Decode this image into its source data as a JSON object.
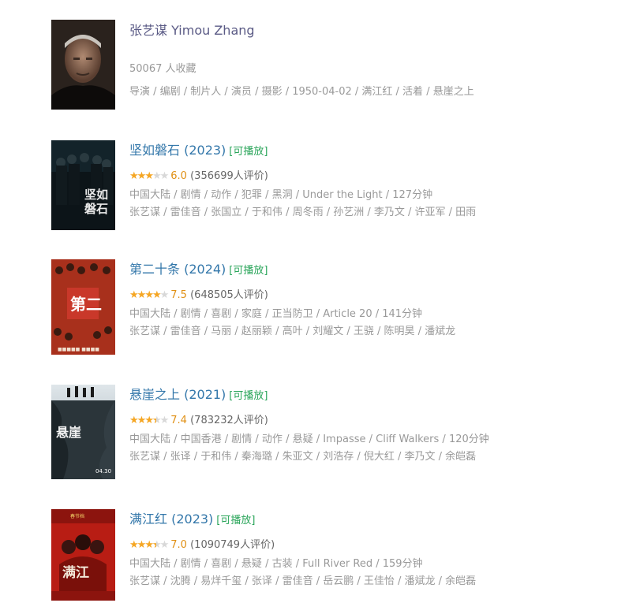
{
  "person": {
    "name": "张艺谋 Yimou Zhang",
    "fans": "50067 人收藏",
    "roles": "导演 / 编剧 / 制片人 / 演员 / 摄影 / 1950-04-02 / 满江红 / 活着 / 悬崖之上"
  },
  "movies": [
    {
      "title": "坚如磐石 (2023)",
      "playable": "[可播放]",
      "rating": 6.0,
      "stars": 3,
      "score": "6.0",
      "votes": "(356699人评价)",
      "genres": "中国大陆 / 剧情 / 动作 / 犯罪 / 黑洞 / Under the Light / 127分钟",
      "cast": "张艺谋 / 雷佳音 / 张国立 / 于和伟 / 周冬雨 / 孙艺洲 / 李乃文 / 许亚军 / 田雨"
    },
    {
      "title": "第二十条 (2024)",
      "playable": "[可播放]",
      "rating": 7.5,
      "stars": 4,
      "score": "7.5",
      "votes": "(648505人评价)",
      "genres": "中国大陆 / 剧情 / 喜剧 / 家庭 / 正当防卫 / Article 20 / 141分钟",
      "cast": "张艺谋 / 雷佳音 / 马丽 / 赵丽颖 / 高叶 / 刘耀文 / 王骁 / 陈明昊 / 潘斌龙"
    },
    {
      "title": "悬崖之上 (2021)",
      "playable": "[可播放]",
      "rating": 7.4,
      "stars": 3.5,
      "score": "7.4",
      "votes": "(783232人评价)",
      "genres": "中国大陆 / 中国香港 / 剧情 / 动作 / 悬疑 / Impasse / Cliff Walkers / 120分钟",
      "cast": "张艺谋 / 张译 / 于和伟 / 秦海璐 / 朱亚文 / 刘浩存 / 倪大红 / 李乃文 / 余皑磊"
    },
    {
      "title": "满江红 (2023)",
      "playable": "[可播放]",
      "rating": 7.0,
      "stars": 3.5,
      "score": "7.0",
      "votes": "(1090749人评价)",
      "genres": "中国大陆 / 剧情 / 喜剧 / 悬疑 / 古装 / Full River Red / 159分钟",
      "cast": "张艺谋 / 沈腾 / 易烊千玺 / 张译 / 雷佳音 / 岳云鹏 / 王佳怡 / 潘斌龙 / 余皑磊"
    }
  ],
  "colors": {
    "link": "#3377aa",
    "star": "#f5a623",
    "playable": "#2aa55a",
    "meta": "#999999"
  }
}
